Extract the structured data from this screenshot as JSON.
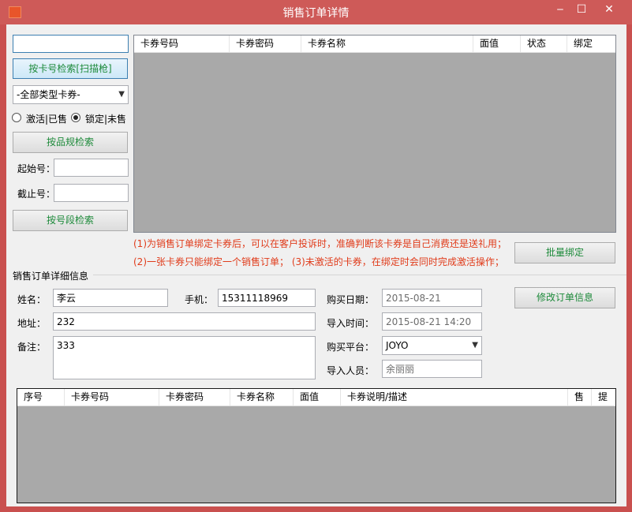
{
  "window": {
    "title": "销售订单详情",
    "minimize": "‒",
    "maximize": "☐",
    "close": "✕"
  },
  "search": {
    "card_input_value": "",
    "scan_button": "按卡号检索[扫描枪]",
    "type_select": "-全部类型卡券-",
    "radio_active": "激活|已售",
    "radio_locked": "锁定|未售",
    "spec_button": "按品规检索",
    "start_label": "起始号：",
    "start_value": "",
    "end_label": "截止号：",
    "end_value": "",
    "range_button": "按号段检索"
  },
  "card_grid": {
    "columns": [
      "卡券号码",
      "卡券密码",
      "卡券名称",
      "面值",
      "状态",
      "绑定"
    ]
  },
  "notes": {
    "line1": "(1)为销售订单绑定卡券后，可以在客户投诉时，准确判断该卡券是自己消费还是送礼用；",
    "line2": "(2)一张卡券只能绑定一个销售订单；  (3)未激活的卡券，在绑定时会同时完成激活操作；"
  },
  "batch_bind_button": "批量绑定",
  "detail": {
    "section_title": "销售订单详细信息",
    "name_label": "姓名：",
    "name_value": "李云",
    "phone_label": "手机：",
    "phone_value": "15311118969",
    "address_label": "地址：",
    "address_value": "232",
    "remark_label": "备注：",
    "remark_value": "333",
    "purchase_date_label": "购买日期：",
    "purchase_date_value": "2015-08-21",
    "import_time_label": "导入时间：",
    "import_time_value": "2015-08-21 14:20",
    "platform_label": "购买平台：",
    "platform_value": "JOYO",
    "importer_label": "导入人员：",
    "importer_value": "余丽丽",
    "modify_button": "修改订单信息"
  },
  "order_grid": {
    "columns": [
      "序号",
      "卡券号码",
      "卡券密码",
      "卡券名称",
      "面值",
      "卡券说明/描述",
      "售",
      "提"
    ]
  }
}
